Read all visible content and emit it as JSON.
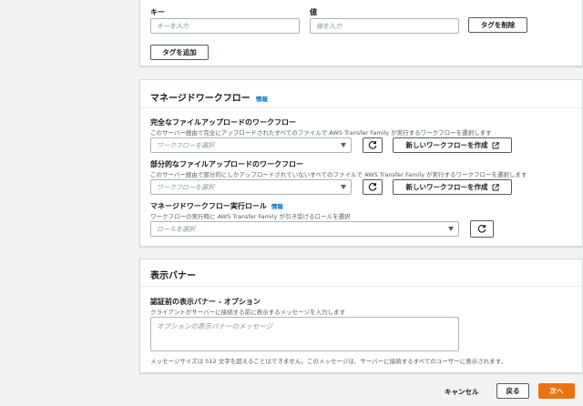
{
  "tags": {
    "key_label": "キー",
    "value_label": "値",
    "key_placeholder": "キーを入力",
    "value_placeholder": "値を入力",
    "remove_button": "タグを削除",
    "add_button": "タグを追加"
  },
  "managed_workflow": {
    "title": "マネージドワークフロー",
    "info": "情報",
    "complete": {
      "label": "完全なファイルアップロードのワークフロー",
      "description": "このサーバー経由で完全にアップロードされたすべてのファイルで AWS Transfer Family が実行するワークフローを選択します",
      "placeholder": "ワークフローを選択",
      "create_button": "新しいワークフローを作成"
    },
    "partial": {
      "label": "部分的なファイルアップロードのワークフロー",
      "description": "このサーバー経由で部分的にしかアップロードされていないすべてのファイルで AWS Transfer Family が実行するワークフローを選択します",
      "placeholder": "ワークフローを選択",
      "create_button": "新しいワークフローを作成"
    },
    "role": {
      "label": "マネージドワークフロー実行ロール",
      "info": "情報",
      "description": "ワークフローの実行時に AWS Transfer Family が引き受けるロールを選択",
      "placeholder": "ロールを選択"
    }
  },
  "banner": {
    "title": "表示バナー",
    "label": "認証前の表示バナー - オプション",
    "description": "クライアントがサーバーに接続する前に表示するメッセージを入力します",
    "placeholder": "オプションの表示バナーのメッセージ",
    "constraint": "メッセージサイズは 512 文字を超えることはできません。このメッセージは、サーバーに接続するすべてのユーザーに表示されます。"
  },
  "footer": {
    "cancel": "キャンセル",
    "back": "戻る",
    "next": "次へ"
  },
  "colors": {
    "primary": "#ec7211",
    "link": "#0073bb"
  }
}
